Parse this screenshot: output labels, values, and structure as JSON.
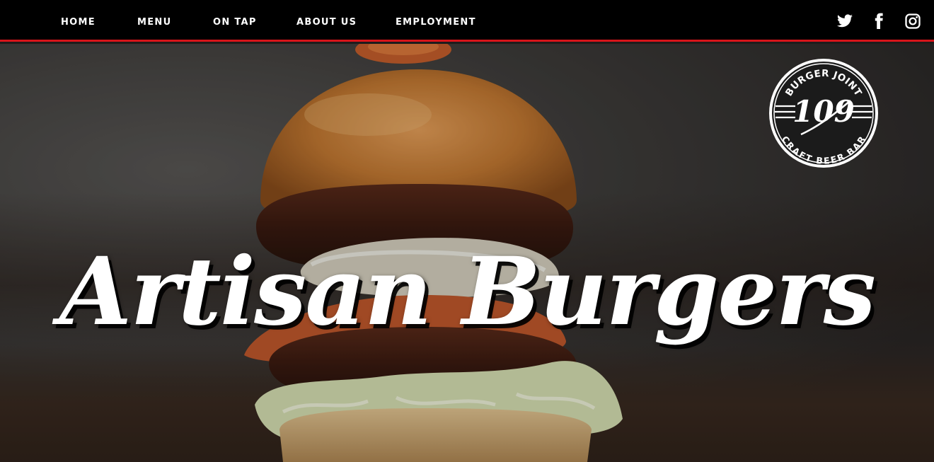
{
  "nav": {
    "items": [
      {
        "label": "HOME"
      },
      {
        "label": "MENU"
      },
      {
        "label": "ON TAP"
      },
      {
        "label": "ABOUT US"
      },
      {
        "label": "EMPLOYMENT"
      }
    ],
    "social": [
      {
        "icon": "twitter-icon"
      },
      {
        "icon": "facebook-icon"
      },
      {
        "icon": "instagram-icon"
      }
    ]
  },
  "logo": {
    "number": "109",
    "top_text": "BURGER JOINT",
    "bottom_text": "CRAFT BEER BAR"
  },
  "hero": {
    "title": "Artisan Burgers"
  },
  "colors": {
    "nav_background": "#000000",
    "accent_red": "#d8141a",
    "text_white": "#ffffff"
  }
}
